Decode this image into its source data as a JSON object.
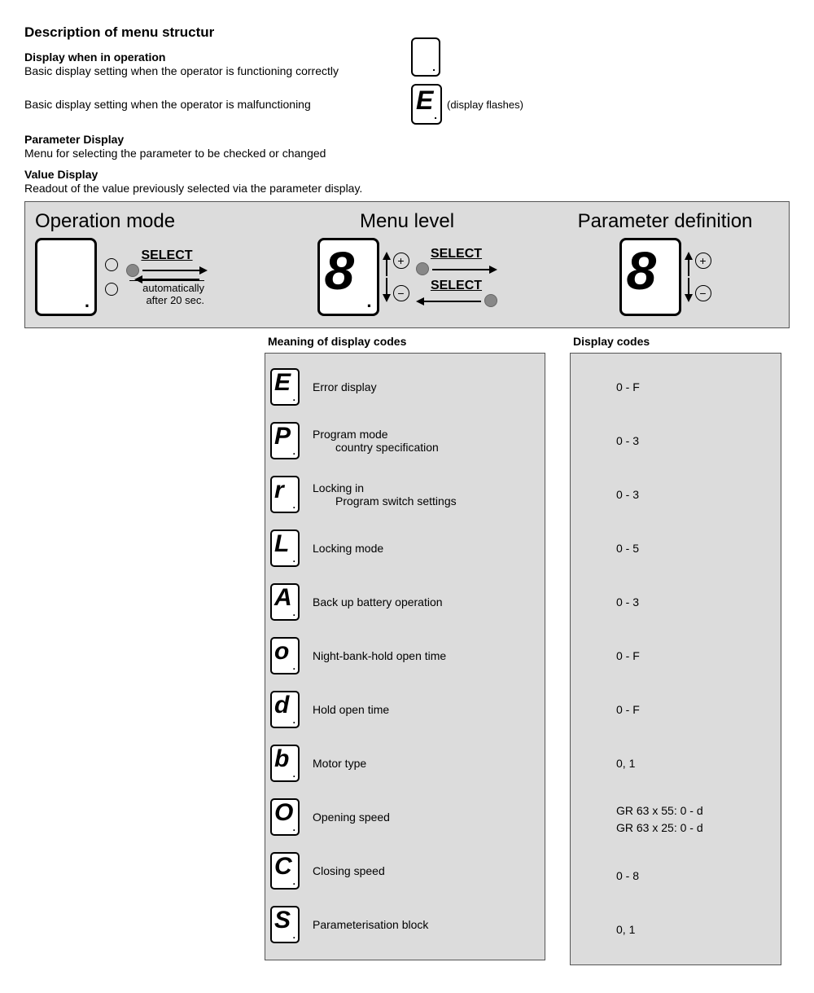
{
  "title": "Description of menu structur",
  "intro": {
    "display_operation": {
      "heading": "Display when in operation",
      "line1": "Basic display setting when the operator is functioning correctly",
      "line2": "Basic display setting when the operator is malfunctioning",
      "flashes_note": "(display flashes)"
    },
    "param_display": {
      "heading": "Parameter Display",
      "body": "Menu for selecting the parameter to be checked or changed"
    },
    "value_display": {
      "heading": "Value Display",
      "body": "Readout of the value previously selected via the parameter display."
    }
  },
  "diagram": {
    "col1": "Operation mode",
    "col2": "Menu level",
    "col3": "Parameter definition",
    "select": "SELECT",
    "auto_line1": "automatically",
    "auto_line2": "after 20 sec.",
    "plus": "+",
    "minus": "−"
  },
  "tables": {
    "meaning_header": "Meaning of display codes",
    "codes_header": "Display codes",
    "rows": [
      {
        "ch": "E",
        "label": "Error display",
        "sub": "",
        "codes": "0 - F"
      },
      {
        "ch": "P",
        "label": "Program mode",
        "sub": "country specification",
        "codes": "0 - 3"
      },
      {
        "ch": "r",
        "label": "Locking in",
        "sub": "Program switch settings",
        "codes": "0 - 3"
      },
      {
        "ch": "L",
        "label": "Locking mode",
        "sub": "",
        "codes": "0 - 5"
      },
      {
        "ch": "A",
        "label": "Back up battery operation",
        "sub": "",
        "codes": "0 - 3"
      },
      {
        "ch": "o",
        "label": "Night-bank-hold open time",
        "sub": "",
        "codes": "0 - F"
      },
      {
        "ch": "d",
        "label": "Hold open time",
        "sub": "",
        "codes": "0 - F"
      },
      {
        "ch": "b",
        "label": "Motor type",
        "sub": "",
        "codes": "0, 1"
      },
      {
        "ch": "O",
        "label": "Opening speed",
        "sub": "",
        "codes": "GR 63 x 55: 0 - d\nGR 63 x 25: 0 - d"
      },
      {
        "ch": "C",
        "label": "Closing speed",
        "sub": "",
        "codes": "0 - 8"
      },
      {
        "ch": "S",
        "label": "Parameterisation block",
        "sub": "",
        "codes": "0, 1"
      }
    ]
  }
}
